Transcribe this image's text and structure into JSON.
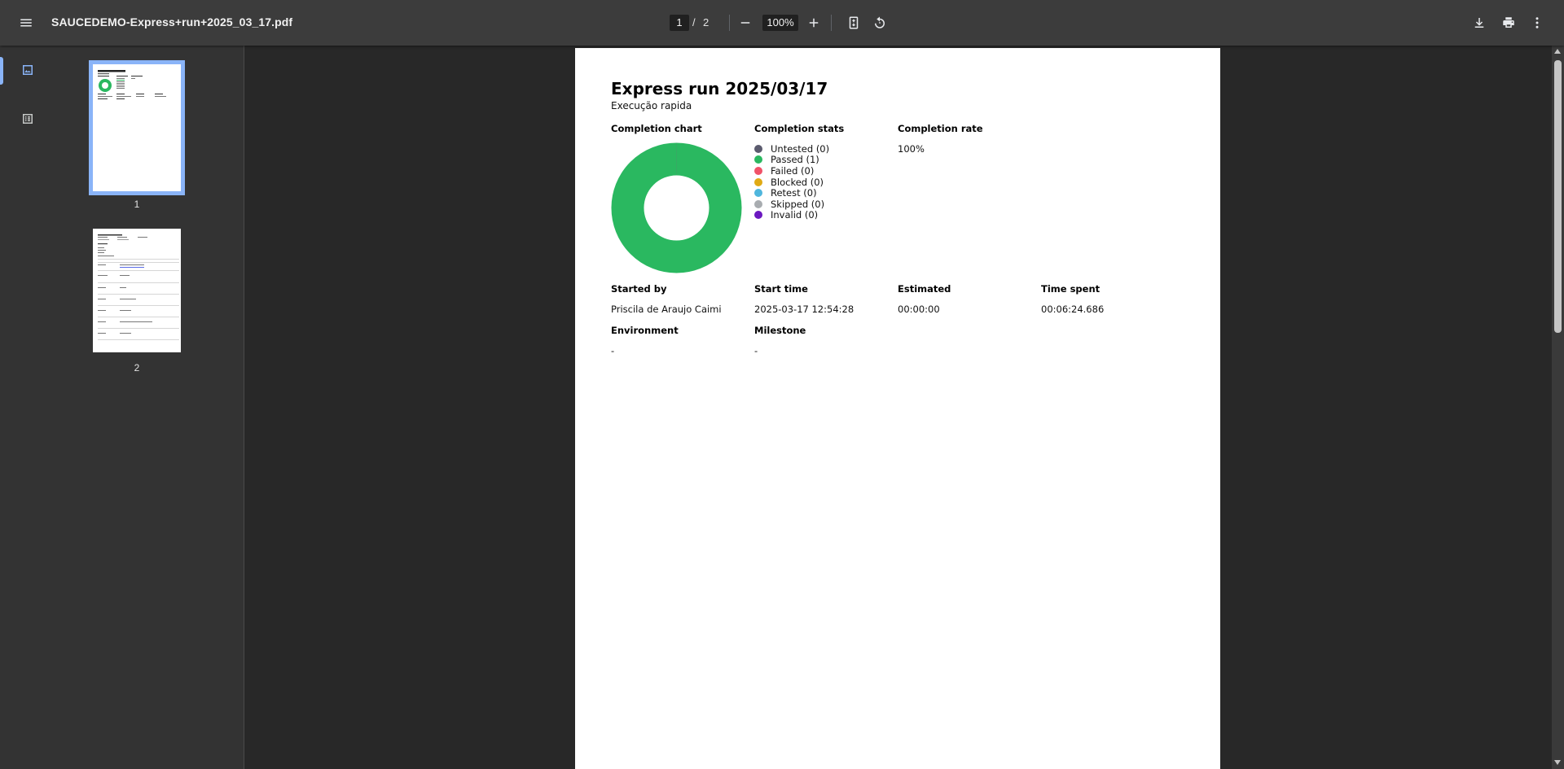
{
  "toolbar": {
    "doc_title": "SAUCEDEMO-Express+run+2025_03_17.pdf",
    "page_current": "1",
    "page_separator": "/",
    "page_total": "2",
    "zoom": "100%"
  },
  "sidebar": {
    "thumbnails": [
      {
        "label": "1"
      },
      {
        "label": "2"
      }
    ]
  },
  "report": {
    "title": "Express run 2025/03/17",
    "subtitle": "Execução rapida",
    "completion_chart_label": "Completion chart",
    "completion_stats_label": "Completion stats",
    "completion_rate_label": "Completion rate",
    "completion_rate_value": "100%",
    "stats": [
      {
        "label": "Untested (0)",
        "color": "#5b5b6e",
        "value": 0
      },
      {
        "label": "Passed (1)",
        "color": "#2ab860",
        "value": 1
      },
      {
        "label": "Failed (0)",
        "color": "#f05268",
        "value": 0
      },
      {
        "label": "Blocked (0)",
        "color": "#e0aa14",
        "value": 0
      },
      {
        "label": "Retest (0)",
        "color": "#4fb6dd",
        "value": 0
      },
      {
        "label": "Skipped (0)",
        "color": "#a8acb0",
        "value": 0
      },
      {
        "label": "Invalid (0)",
        "color": "#6b18c0",
        "value": 0
      }
    ],
    "started_by_label": "Started by",
    "started_by_value": "Priscila de Araujo Caimi",
    "start_time_label": "Start time",
    "start_time_value": "2025-03-17 12:54:28",
    "estimated_label": "Estimated",
    "estimated_value": "00:00:00",
    "time_spent_label": "Time spent",
    "time_spent_value": "00:06:24.686",
    "environment_label": "Environment",
    "environment_value": "-",
    "milestone_label": "Milestone",
    "milestone_value": "-"
  },
  "chart_data": {
    "type": "pie",
    "categories": [
      "Untested",
      "Passed",
      "Failed",
      "Blocked",
      "Retest",
      "Skipped",
      "Invalid"
    ],
    "values": [
      0,
      1,
      0,
      0,
      0,
      0,
      0
    ],
    "colors": [
      "#5b5b6e",
      "#2ab860",
      "#f05268",
      "#e0aa14",
      "#4fb6dd",
      "#a8acb0",
      "#6b18c0"
    ],
    "title": "Completion chart",
    "legend": "right"
  },
  "icons": {
    "menu": "menu-icon",
    "zoom_out": "minus-icon",
    "zoom_in": "plus-icon",
    "fit": "fit-page-icon",
    "rotate": "rotate-icon",
    "download": "download-icon",
    "print": "print-icon",
    "more": "more-vert-icon",
    "thumbnails": "image-icon",
    "outline": "list-icon"
  },
  "colors": {
    "accent": "#8ab4f8",
    "toolbar": "#3c3c3c",
    "viewer_bg": "#282828",
    "sidebar_bg": "#333333"
  }
}
